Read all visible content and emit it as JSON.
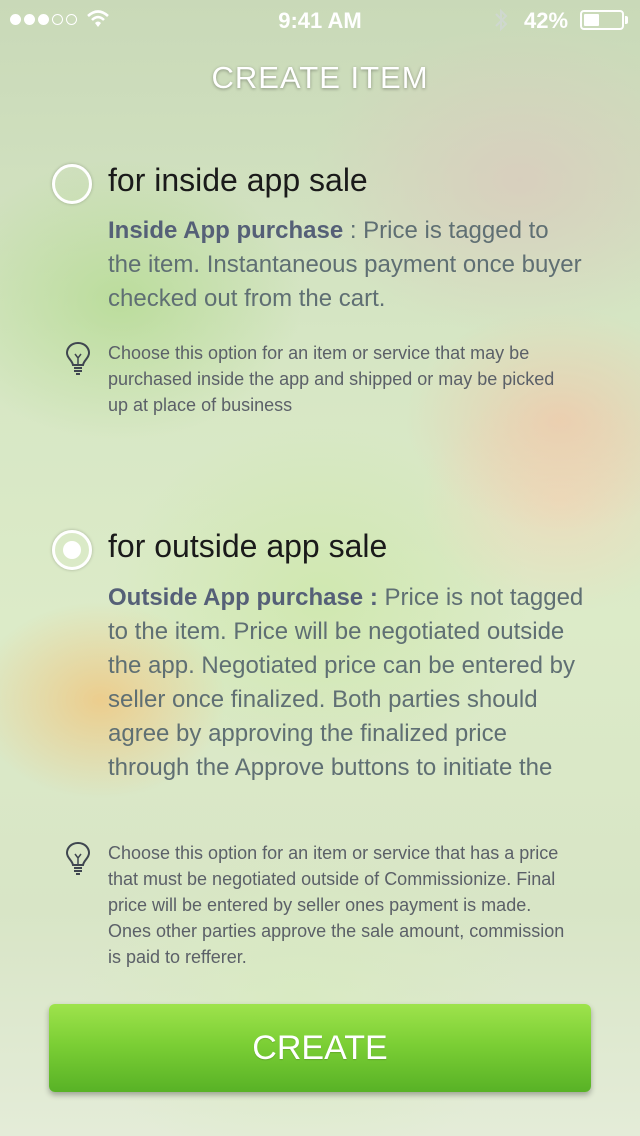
{
  "status_bar": {
    "time": "9:41 AM",
    "battery_percent": "42%",
    "battery_level": 0.42,
    "signal_bars_filled": 3,
    "signal_bars_total": 5,
    "icons": [
      "signal-dots-icon",
      "wifi-icon",
      "bluetooth-icon",
      "battery-icon"
    ]
  },
  "header": {
    "title": "CREATE ITEM"
  },
  "options": [
    {
      "title": "for inside app sale",
      "selected": false,
      "desc_bold": "Inside App purchase",
      "desc_rest": " : Price is tagged to the item. Instantaneous payment once buyer checked out from the cart.",
      "hint": "Choose this option for an item or service that may be purchased inside the app and shipped or may be picked up at place of business"
    },
    {
      "title": "for outside app sale",
      "selected": true,
      "desc_bold": "Outside App purchase :",
      "desc_rest": " Price is not tagged to the item. Price will be negotiated outside the app. Negotiated price can be entered by seller once finalized. Both parties should agree by approving the finalized price through the Approve buttons to initiate the",
      "hint": "Choose this option for an item or service that has a price that must be negotiated outside of Commissionize. Final price will be entered by seller ones payment is made. Ones other parties approve the sale amount, commission is paid to refferer."
    }
  ],
  "create_button": {
    "label": "CREATE"
  },
  "colors": {
    "button_top": "#9ee34c",
    "button_bottom": "#58b226",
    "desc_text": "#5f6f73"
  }
}
